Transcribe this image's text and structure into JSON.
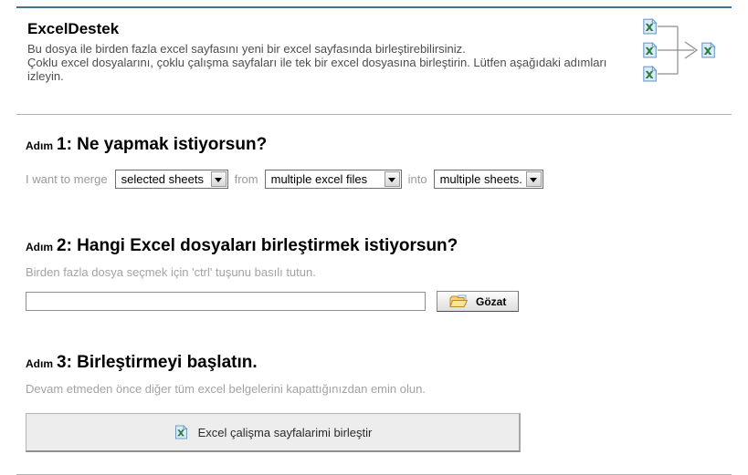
{
  "header": {
    "title": "ExcelDestek",
    "description_line1": "Bu dosya ile birden fazla excel sayfasını yeni bir excel sayfasında birleştirebilirsiniz.",
    "description_line2": "Çoklu excel dosyalarını, çoklu çalışma sayfaları ile tek bir excel dosyasına birleştirin. Lütfen aşağıdaki adımları izleyin."
  },
  "step1": {
    "prefix": "Adım",
    "title": "1: Ne yapmak istiyorsun?",
    "label_merge": "I want to merge",
    "sheets_value": "selected sheets",
    "label_from": "from",
    "files_value": "multiple excel files",
    "label_into": "into",
    "target_value": "multiple sheets."
  },
  "step2": {
    "prefix": "Adım",
    "title": "2: Hangi Excel dosyaları birleştirmek istiyorsun?",
    "hint": "Birden fazla dosya seçmek için 'ctrl' tuşunu basılı tutun.",
    "file_input_value": "",
    "browse_label": "Gözat"
  },
  "step3": {
    "prefix": "Adım",
    "title": "3: Birleştirmeyi başlatın.",
    "hint": "Devam etmeden önce diğer tüm excel belgelerini kapattığınızdan emin olun.",
    "merge_button_label": "Excel çalişma sayfalarimi birleştir"
  },
  "icons": {
    "excel_file": "excel-file-icon",
    "folder_open": "folder-open-icon",
    "dropdown_arrow": "chevron-down-icon"
  },
  "colors": {
    "top_rule": "#43708f",
    "divider": "#b3b3b3",
    "muted_text": "#a3a3a3",
    "excel_green": "#2f7d44",
    "folder_yellow": "#f6d376"
  }
}
